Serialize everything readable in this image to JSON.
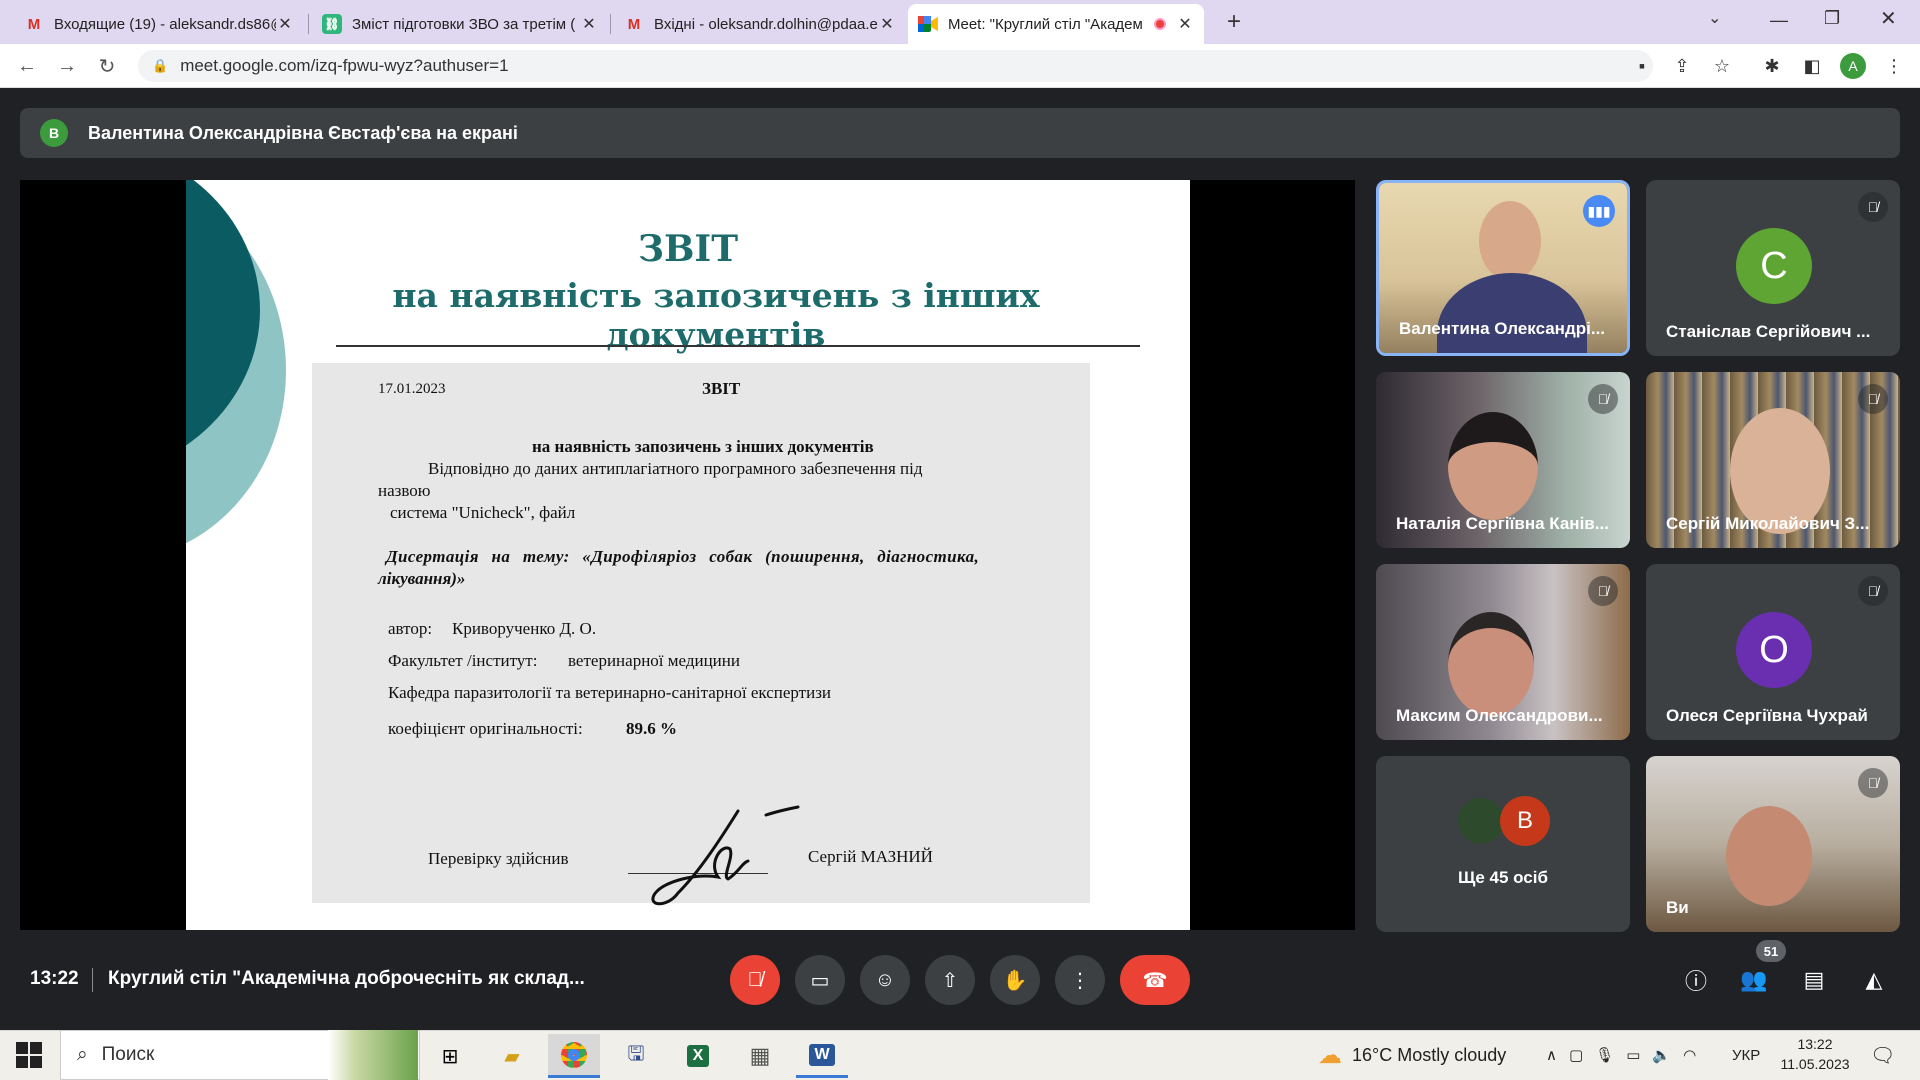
{
  "browser": {
    "tabs": [
      {
        "label": "Входящие (19) - aleksandr.ds86@",
        "favicon": "gmail-icon",
        "active": false
      },
      {
        "label": "Зміст підготовки ЗВО за третім (",
        "favicon": "link-icon",
        "active": false
      },
      {
        "label": "Вхідні - oleksandr.dolhin@pdaa.e",
        "favicon": "gmail-icon",
        "active": false
      },
      {
        "label": "Meet: \"Круглий стіл \"Академ",
        "favicon": "meet-icon",
        "active": true
      }
    ],
    "url": "meet.google.com/izq-fpwu-wyz?authuser=1",
    "profile_initial": "A"
  },
  "meet": {
    "presenting_initial": "В",
    "presenting_text": "Валентина Олександрівна Євстаф'єва на екрані",
    "slide": {
      "title_line1": "ЗВІТ",
      "title_line2": "на наявність запозичень з інших документів",
      "doc_date": "17.01.2023",
      "doc_heading": "ЗВІТ",
      "doc_subheading": "на наявність запозичень з інших документів",
      "doc_line1": "Відповідно до даних антиплагіатного програмного забезпечення під",
      "doc_line2": "назвою",
      "doc_line3": "система \"Unicheck\", файл",
      "doc_theme": "Дисертація на тему: «Дирофіляріоз собак (поширення, діагностика,",
      "doc_theme2": "лікування)»",
      "author_label": "автор:",
      "author_value": "Криворученко Д. О.",
      "faculty_label": "Факультет /інститут:",
      "faculty_value": "ветеринарної медицини",
      "department": "Кафедра паразитології та ветеринарно-санітарної експертизи",
      "originality_label": "коефіцієнт оригінальності:",
      "originality_value": "89.6 %",
      "checked_by_label": "Перевірку здійснив",
      "checked_by_name": "Сергій МАЗНИЙ"
    },
    "participants": [
      {
        "name": "Валентина Олександрі...",
        "type": "video",
        "speaking": true
      },
      {
        "name": "Станіслав Сергійович ...",
        "type": "avatar",
        "initial": "С",
        "color": "#5fa533",
        "muted": true
      },
      {
        "name": "Наталія Сергіївна Канів...",
        "type": "video",
        "muted": true
      },
      {
        "name": "Сергій Миколайович З...",
        "type": "video",
        "muted": true
      },
      {
        "name": "Максим Олександрови...",
        "type": "video",
        "muted": true
      },
      {
        "name": "Олеся Сергіївна Чухрай",
        "type": "avatar",
        "initial": "О",
        "color": "#6a2fb0",
        "muted": true
      },
      {
        "name": "Ще 45 осіб",
        "type": "more",
        "initial": "В"
      },
      {
        "name": "Ви",
        "type": "video",
        "muted": true
      }
    ],
    "time": "13:22",
    "meeting_title": "Круглий стіл \"Академічна доброчесніть як склад...",
    "people_count": "51"
  },
  "taskbar": {
    "search_placeholder": "Поиск",
    "weather": "16°C  Mostly cloudy",
    "lang": "УКР",
    "clock_time": "13:22",
    "clock_date": "11.05.2023"
  }
}
